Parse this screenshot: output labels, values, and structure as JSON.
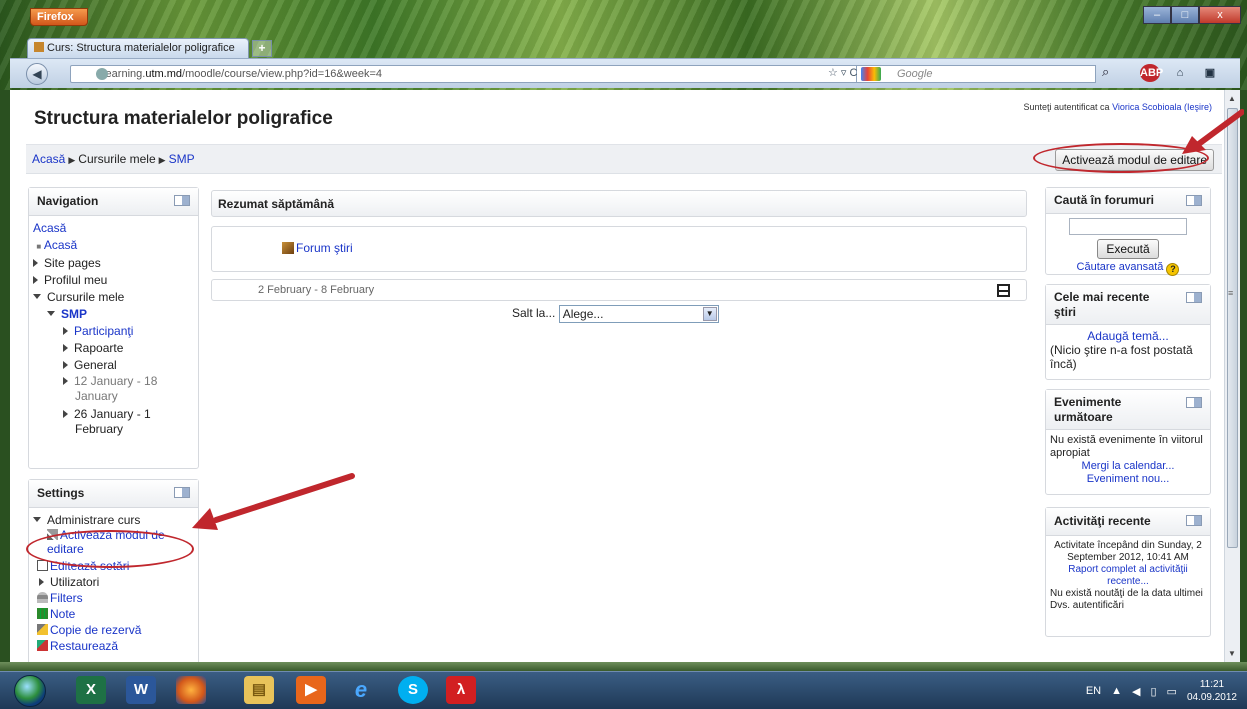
{
  "browser": {
    "app_button": "Firefox",
    "tab_title": "Curs: Structura materialelor poligrafice",
    "new_tab": "+",
    "url_prefix": "elearning.",
    "url_domain": "utm.md",
    "url_path": "/moodle/course/view.php?id=16&week=4",
    "search_placeholder": "Google",
    "minimize": "–",
    "maximize": "□",
    "close": "x"
  },
  "page": {
    "title": "Structura materialelor poligrafice",
    "login_text": "Sunteţi autentificat ca",
    "login_user": "Viorica Scobioala",
    "logout": "(Ieşire)",
    "edit_button": "Activează modul de editare",
    "breadcrumb": [
      "Acasă",
      "Cursurile mele",
      "SMP"
    ]
  },
  "navigation": {
    "title": "Navigation",
    "home": "Acasă",
    "home_bullet": "Acasă",
    "site_pages": "Site pages",
    "profile": "Profilul meu",
    "my_courses": "Cursurile mele",
    "course": "SMP",
    "participants": "Participanţi",
    "reports": "Rapoarte",
    "general": "General",
    "week1_line1": "12 January - 18",
    "week1_line2": "January",
    "week2_line1": "26 January - 1",
    "week2_line2": "February"
  },
  "settings": {
    "title": "Settings",
    "admin": "Administrare curs",
    "edit_mode_1": "Activează modul de",
    "edit_mode_2": "editare",
    "edit_settings": "Editează setări",
    "users": "Utilizatori",
    "filters": "Filters",
    "grades": "Note",
    "backup": "Copie de rezervă",
    "restore": "Restaurează"
  },
  "main": {
    "summary_title": "Rezumat săptămână",
    "forum": "Forum ştiri",
    "week_range": "2 February - 8 February",
    "jump_label": "Salt la...",
    "jump_value": "Alege..."
  },
  "forum_search": {
    "title": "Caută în forumuri",
    "button": "Execută",
    "advanced": "Căutare avansată",
    "help": "?"
  },
  "news": {
    "title_1": "Cele mai recente",
    "title_2": "ştiri",
    "add": "Adaugă temă...",
    "empty": "(Nicio ştire n-a fost postată încă)"
  },
  "events": {
    "title_1": "Evenimente",
    "title_2": "următoare",
    "empty": "Nu există evenimente în viitorul apropiat",
    "calendar": "Mergi la calendar...",
    "new_event": "Eveniment nou..."
  },
  "recent": {
    "title": "Activităţi recente",
    "since": "Activitate începând din Sunday, 2 September 2012, 10:41 AM",
    "full_report": "Raport complet al activităţii recente...",
    "none": "Nu există noutăţi de la data ultimei Dvs. autentificări"
  },
  "taskbar": {
    "lang": "EN",
    "time": "11:21",
    "date": "04.09.2012",
    "apps": [
      "excel-icon",
      "word-icon",
      "firefox-icon",
      "explorer-icon",
      "media-player-icon",
      "ie-icon",
      "skype-icon",
      "acrobat-icon"
    ]
  },
  "colors": {
    "link": "#1a35c8",
    "annotation_red": "#c0272d",
    "taskbar": "#1f3956"
  }
}
